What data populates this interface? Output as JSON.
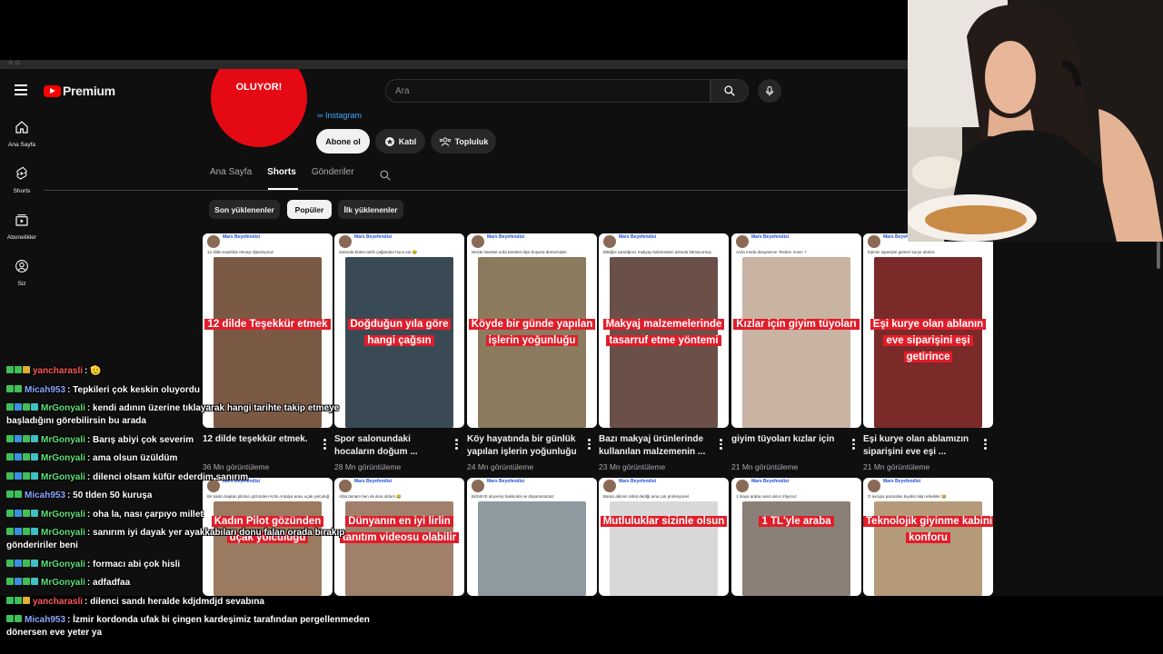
{
  "youtube": {
    "brand": "Premium",
    "search_placeholder": "Ara",
    "guide": [
      {
        "label": "Ana Sayfa",
        "icon": "home-icon"
      },
      {
        "label": "Shorts",
        "icon": "shorts-icon"
      },
      {
        "label": "Abonelikler",
        "icon": "subscriptions-icon"
      },
      {
        "label": "Siz",
        "icon": "you-icon"
      }
    ],
    "channel": {
      "avatar_text": "OLUYOR!",
      "instagram_link": "Instagram",
      "subscribe_label": "Abone ol",
      "join_label": "Katıl",
      "community_label": "Topluluk"
    },
    "tabs": [
      {
        "label": "Ana Sayfa",
        "active": false
      },
      {
        "label": "Shorts",
        "active": true
      },
      {
        "label": "Gönderiler",
        "active": false
      }
    ],
    "chips": [
      {
        "label": "Son yüklenenler",
        "active": false
      },
      {
        "label": "Popüler",
        "active": true
      },
      {
        "label": "İlk yüklenenler",
        "active": false
      }
    ],
    "shorts_row1": [
      {
        "account": "Mars Beyefendisi",
        "tweet": "12 dilde teşekkür etmeyi öğreniyoruz",
        "caption": "12 dilde Teşekkür etmek",
        "title_line1": "12 dilde teşekkür etmek.",
        "title_line2": "",
        "views": "36 Mn görüntüleme",
        "photo": "#7a5a45"
      },
      {
        "account": "Mars Beyefendisi",
        "tweet": "Salonda bütün tarihi çağlardan hoca var 😂",
        "caption": "Doğduğun yıla göre hangi çağsın",
        "title_line1": "Spor salonundaki",
        "title_line2": "hocaların doğum ...",
        "views": "28 Mn görüntüleme",
        "photo": "#3a4a55"
      },
      {
        "account": "Mars Beyefendisi",
        "tweet": "Nerde hareket orda bereket diye boşuna dememişler",
        "caption": "Köyde bir günde yapılan işlerin yoğunluğu",
        "title_line1": "Köy hayatında bir günlük",
        "title_line2": "yapılan işlerin yoğunluğu",
        "views": "24 Mn görüntüleme",
        "photo": "#8c7a5e"
      },
      {
        "account": "Mars Beyefendisi",
        "tweet": "Bittiğini sandığınız makyaj malzemeleri aslında bitmiyormuş",
        "caption": "Makyaj malzemelerinde tasarruf etme yöntemi",
        "title_line1": "Bazı makyaj ürünlerinde",
        "title_line2": "kullanılan malzemenin ...",
        "views": "23 Mn görüntüleme",
        "photo": "#6a5048"
      },
      {
        "account": "Mars Beyefendisi",
        "tweet": "Acila moda dünyasının Tesla'sı mısın ?",
        "caption": "Kızlar için giyim tüyoları",
        "title_line1": "giyim tüyoları kızlar için",
        "title_line2": "",
        "views": "21 Mn görüntüleme",
        "photo": "#c9b3a3"
      },
      {
        "account": "Mars Beyefendisi",
        "tweet": "Eşimin siparişini getiren kurye abimiz",
        "caption": "Eşi kurye olan ablanın eve siparişini eşi getirince",
        "title_line1": "Eşi kurye olan ablamızın",
        "title_line2": "siparişini eve eşi ...",
        "views": "21 Mn görüntüleme",
        "photo": "#7b2a2a"
      }
    ],
    "shorts_row2": [
      {
        "account": "Mars Beyefendisi",
        "tweet": "Bir kadın kaptan pilotun gözünden Köln Antalya arası uçak yolculuğu",
        "caption": "Kadın Pilot gözünden uçak yolculuğu",
        "photo": "#9a7a60"
      },
      {
        "account": "Mars Beyefendisi",
        "tweet": "Abla tamam ben de ikna oldum 😂",
        "caption": "Dünyanın en iyi lirlin tanıtım videosu olabilir",
        "photo": "#a0806a"
      },
      {
        "account": "Mars Beyefendisi",
        "tweet": "Bizbİm'E alışveriş hakkında ne düşünürsünüz",
        "caption": "",
        "photo": "#8f9aa0"
      },
      {
        "account": "Mars Beyefendisi",
        "tweet": "Baran abimin rahat dediği ama çok profesyonel",
        "caption": "Mutluluklar sizinle olsun",
        "photo": "#d8d8d8"
      },
      {
        "account": "Mars Beyefendisi",
        "tweet": "1 liraya araba nasıl alınır izliyoruz",
        "caption": "1 TL'yle araba",
        "photo": "#8a8078"
      },
      {
        "account": "Mars Beyefendisi",
        "tweet": "O avrupa pazardan kıyafet alan erkekler 😂",
        "caption": "Teknolojik giyinme kabini konforu",
        "photo": "#b59a7a"
      }
    ]
  },
  "chat": [
    {
      "user": "yancharasli",
      "user_color": "#ff5a5a",
      "badges": [
        "#3fbf5a",
        "#3fbf5a",
        "#e0b030"
      ],
      "text": ": 🫡"
    },
    {
      "user": "Micah953",
      "user_color": "#8aa7ff",
      "badges": [
        "#3fbf5a",
        "#3fbf5a"
      ],
      "text": ": Tepkileri çok keskin oluyordu"
    },
    {
      "user": "MrGonyali",
      "user_color": "#5fe07a",
      "badges": [
        "#3fbf5a",
        "#3a8fe0",
        "#3fbf5a",
        "#40c0c0"
      ],
      "text": ": kendi adının üzerine tıklayarak hangi tarihte takip etmeye başladığını görebilirsin bu arada"
    },
    {
      "user": "MrGonyali",
      "user_color": "#5fe07a",
      "badges": [
        "#3fbf5a",
        "#3a8fe0",
        "#3fbf5a",
        "#40c0c0"
      ],
      "text": ": Barış abiyi çok severim"
    },
    {
      "user": "MrGonyali",
      "user_color": "#5fe07a",
      "badges": [
        "#3fbf5a",
        "#3a8fe0",
        "#3fbf5a",
        "#40c0c0"
      ],
      "text": ": ama olsun üzüldüm"
    },
    {
      "user": "MrGonyali",
      "user_color": "#5fe07a",
      "badges": [
        "#3fbf5a",
        "#3a8fe0",
        "#3fbf5a",
        "#40c0c0"
      ],
      "text": ": dilenci olsam küfür ederdim sanırım"
    },
    {
      "user": "Micah953",
      "user_color": "#8aa7ff",
      "badges": [
        "#3fbf5a",
        "#3fbf5a"
      ],
      "text": ": 50 tlden 50 kuruşa"
    },
    {
      "user": "MrGonyali",
      "user_color": "#5fe07a",
      "badges": [
        "#3fbf5a",
        "#3a8fe0",
        "#3fbf5a",
        "#40c0c0"
      ],
      "text": ": oha la, nası çarpıyo millet"
    },
    {
      "user": "MrGonyali",
      "user_color": "#5fe07a",
      "badges": [
        "#3fbf5a",
        "#3a8fe0",
        "#3fbf5a",
        "#40c0c0"
      ],
      "text": ": sanırım iyi dayak yer ayakkabıları donu falan orada bırakıp göndeririler beni"
    },
    {
      "user": "MrGonyali",
      "user_color": "#5fe07a",
      "badges": [
        "#3fbf5a",
        "#3a8fe0",
        "#3fbf5a",
        "#40c0c0"
      ],
      "text": ": formacı abi çok hisli"
    },
    {
      "user": "MrGonyali",
      "user_color": "#5fe07a",
      "badges": [
        "#3fbf5a",
        "#3a8fe0",
        "#3fbf5a",
        "#40c0c0"
      ],
      "text": ": adfadfaa"
    },
    {
      "user": "yancharasli",
      "user_color": "#ff5a5a",
      "badges": [
        "#3fbf5a",
        "#3fbf5a",
        "#e0b030"
      ],
      "text": ": dilenci sandı heralde kdjdmdjd sevabına"
    },
    {
      "user": "Micah953",
      "user_color": "#8aa7ff",
      "badges": [
        "#3fbf5a",
        "#3fbf5a"
      ],
      "text": ": İzmir kordonda ufak bi çingen kardeşimiz tarafından pergellenmeden dönersen eve yeter ya"
    }
  ]
}
